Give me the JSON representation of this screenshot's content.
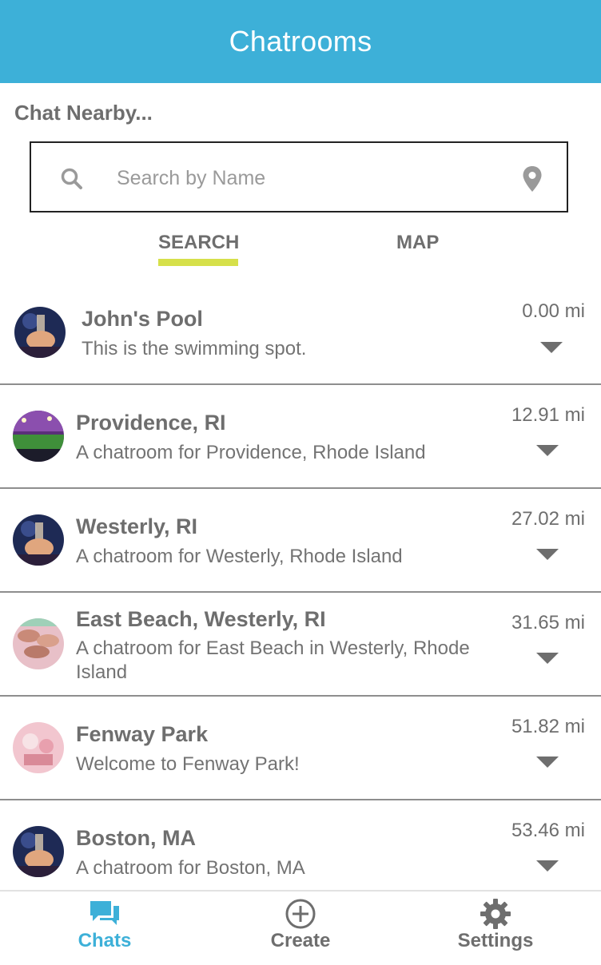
{
  "header": {
    "title": "Chatrooms"
  },
  "section": {
    "label": "Chat Nearby..."
  },
  "search": {
    "placeholder": "Search by Name",
    "value": ""
  },
  "tabs": [
    {
      "label": "SEARCH",
      "active": true
    },
    {
      "label": "MAP",
      "active": false
    }
  ],
  "chatrooms": [
    {
      "name": "John's Pool",
      "description": "This is the swimming spot.",
      "distance": "0.00 mi",
      "avatar": "party-photo"
    },
    {
      "name": "Providence, RI",
      "description": "A chatroom for Providence, Rhode Island",
      "distance": "12.91 mi",
      "avatar": "stadium-photo"
    },
    {
      "name": "Westerly, RI",
      "description": "A chatroom for Westerly, Rhode Island",
      "distance": "27.02 mi",
      "avatar": "party-photo"
    },
    {
      "name": "East Beach, Westerly, RI",
      "description": "A chatroom for East Beach in Westerly, Rhode Island",
      "distance": "31.65 mi",
      "avatar": "hands-photo"
    },
    {
      "name": "Fenway Park",
      "description": "Welcome to Fenway Park!",
      "distance": "51.82 mi",
      "avatar": "toast-photo"
    },
    {
      "name": "Boston, MA",
      "description": "A chatroom for Boston, MA",
      "distance": "53.46 mi",
      "avatar": "party-photo"
    }
  ],
  "bottom_nav": [
    {
      "label": "Chats",
      "icon": "chat-bubbles-icon",
      "active": true
    },
    {
      "label": "Create",
      "icon": "plus-circle-icon",
      "active": false
    },
    {
      "label": "Settings",
      "icon": "gear-icon",
      "active": false
    }
  ],
  "colors": {
    "header": "#3db0d8",
    "accent": "#d6e04a",
    "active_nav": "#3db0d8",
    "text": "#6e6e6e"
  }
}
